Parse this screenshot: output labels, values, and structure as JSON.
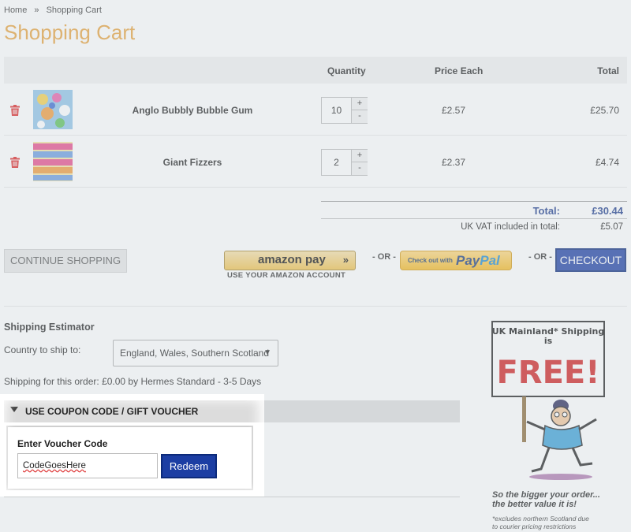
{
  "breadcrumb": {
    "home": "Home",
    "sep": "»",
    "current": "Shopping Cart"
  },
  "page_title": "Shopping Cart",
  "table": {
    "headers": {
      "quantity": "Quantity",
      "price": "Price Each",
      "total": "Total"
    },
    "rows": [
      {
        "name": "Anglo Bubbly Bubble Gum",
        "qty": "10",
        "price": "£2.57",
        "total": "£25.70"
      },
      {
        "name": "Giant Fizzers",
        "qty": "2",
        "price": "£2.37",
        "total": "£4.74"
      }
    ],
    "qty_plus": "+",
    "qty_minus": "-"
  },
  "totals": {
    "total_label": "Total:",
    "total_value": "£30.44",
    "vat_label": "UK VAT included in total:",
    "vat_value": "£5.07"
  },
  "actions": {
    "continue": "CONTINUE SHOPPING",
    "amazon": "amazon pay",
    "amazon_arrows": "»",
    "amazon_sub": "USE YOUR AMAZON ACCOUNT",
    "or": "- OR -",
    "paypal_small": "Check out with",
    "paypal_pay": "Pay",
    "paypal_pal": "Pal",
    "checkout": "CHECKOUT"
  },
  "shipping": {
    "title": "Shipping Estimator",
    "country_label": "Country to ship to:",
    "country_value": "England, Wales, Southern Scotland",
    "info": "Shipping for this order: £0.00 by Hermes Standard - 3-5 Days"
  },
  "coupon": {
    "bar_label": "USE COUPON CODE / GIFT VOUCHER",
    "enter_label": "Enter Voucher Code",
    "value": "CodeGoesHere",
    "redeem": "Redeem"
  },
  "promo": {
    "sign_top": "UK Mainland* Shipping",
    "sign_is": "is",
    "sign_free": "FREE!",
    "line1": "So the bigger your order...",
    "line2": "the better value it is!",
    "foot1": "*excludes northern Scotland due",
    "foot2": "to courier pricing restrictions"
  },
  "colors": {
    "title": "#e9a23b",
    "accent": "#1c3ea3",
    "total": "#1b3a8a",
    "free_red": "#d22020"
  }
}
